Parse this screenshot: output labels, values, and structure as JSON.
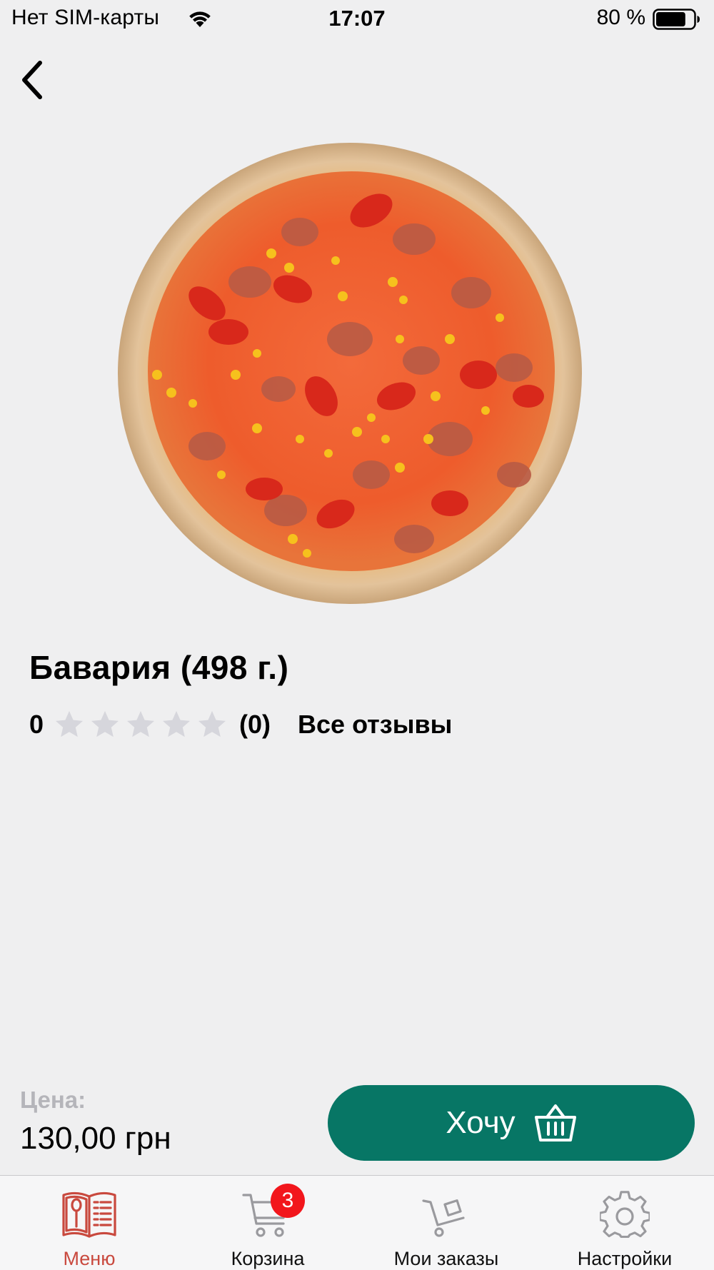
{
  "status_bar": {
    "carrier": "Нет SIM-карты",
    "time": "17:07",
    "battery_percent_text": "80 %",
    "battery_level": 0.8
  },
  "product": {
    "title": "Бавария (498 г.)",
    "image_icon": "pizza-photo",
    "rating_value": "0",
    "stars_total": 5,
    "stars_filled": 0,
    "rating_count": "(0)",
    "all_reviews_label": "Все отзывы"
  },
  "purchase": {
    "price_label": "Цена:",
    "price_value": "130,00 грн",
    "want_button_label": "Хочу"
  },
  "tab_bar": {
    "items": [
      {
        "label": "Меню",
        "icon": "menu-book-icon",
        "active": true
      },
      {
        "label": "Корзина",
        "icon": "cart-icon",
        "badge": "3"
      },
      {
        "label": "Мои заказы",
        "icon": "orders-cart-icon"
      },
      {
        "label": "Настройки",
        "icon": "gear-icon"
      }
    ]
  },
  "colors": {
    "accent_green": "#077665",
    "active_tab": "#c9493e",
    "badge_red": "#f2161c",
    "star_empty": "#d6d6dc",
    "background": "#efeff0"
  }
}
